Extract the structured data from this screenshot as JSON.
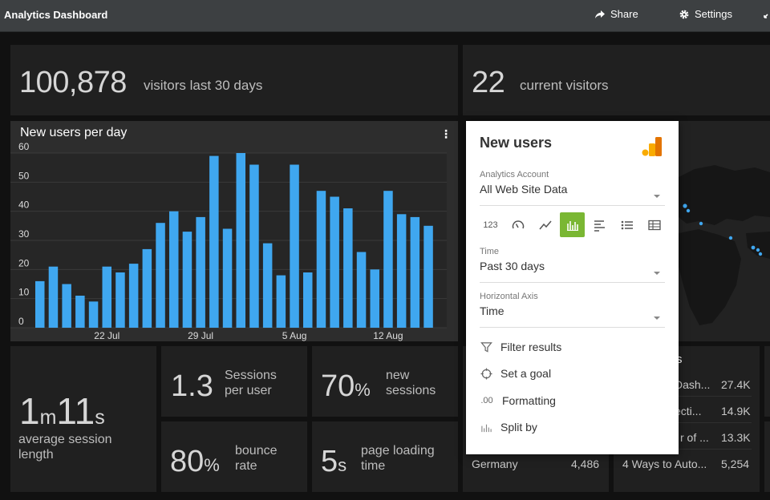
{
  "header": {
    "title": "Analytics Dashboard",
    "share_label": "Share",
    "settings_label": "Settings"
  },
  "visitors": {
    "value": "100,878",
    "label": "visitors last 30 days"
  },
  "current": {
    "value": "22",
    "label": "current visitors"
  },
  "chart": {
    "title": "New users per day",
    "more": "⋮"
  },
  "chart_data": {
    "type": "bar",
    "title": "New users per day",
    "x_tick_labels": [
      "22 Jul",
      "29 Jul",
      "5 Aug",
      "12 Aug"
    ],
    "y_ticks": [
      0,
      10,
      20,
      30,
      40,
      50,
      60
    ],
    "ylim": [
      0,
      60
    ],
    "values": [
      16,
      21,
      15,
      11,
      9,
      21,
      19,
      22,
      27,
      36,
      40,
      33,
      38,
      59,
      34,
      60,
      56,
      29,
      18,
      56,
      19,
      47,
      45,
      41,
      26,
      20,
      47,
      39,
      38,
      35
    ],
    "bar_color": "#3fa7f0",
    "grid": true
  },
  "session_length": {
    "minutes": "1",
    "m_unit": "m",
    "seconds": "11",
    "s_unit": "s",
    "label_1": "average session",
    "label_2": "length"
  },
  "sessions_per_user": {
    "value": "1.3",
    "label_1": "Sessions",
    "label_2": "per user"
  },
  "new_sessions": {
    "value": "70",
    "unit": "%",
    "label_1": "new",
    "label_2": "sessions"
  },
  "bounce": {
    "value": "80",
    "unit": "%",
    "label_1": "bounce",
    "label_2": "rate"
  },
  "page_loading": {
    "value": "5",
    "unit": "s",
    "label_1": "page loading",
    "label_2": "time"
  },
  "countries": {
    "rows": [
      {
        "name": "Germany",
        "value": "4,486"
      }
    ]
  },
  "pages": {
    "title_tail": "s",
    "rows": [
      {
        "name": "Dash...",
        "value": "27.4K"
      },
      {
        "name": "ecti...",
        "value": "14.9K"
      },
      {
        "name": "r of ...",
        "value": "13.3K"
      },
      {
        "name": "4 Ways to Auto...",
        "value": "5,254"
      }
    ]
  },
  "popup": {
    "title": "New users",
    "account_label": "Analytics Account",
    "account_value": "All Web Site Data",
    "viz_number_label": "123",
    "time_label": "Time",
    "time_value": "Past 30 days",
    "axis_label": "Horizontal Axis",
    "axis_value": "Time",
    "menu": [
      "Filter results",
      "Set a goal",
      "Formatting",
      "Split by"
    ],
    "formatting_icon_text": ".00",
    "accent": "#7ab733",
    "logo_colors": [
      "#f9ab00",
      "#e37400"
    ]
  }
}
